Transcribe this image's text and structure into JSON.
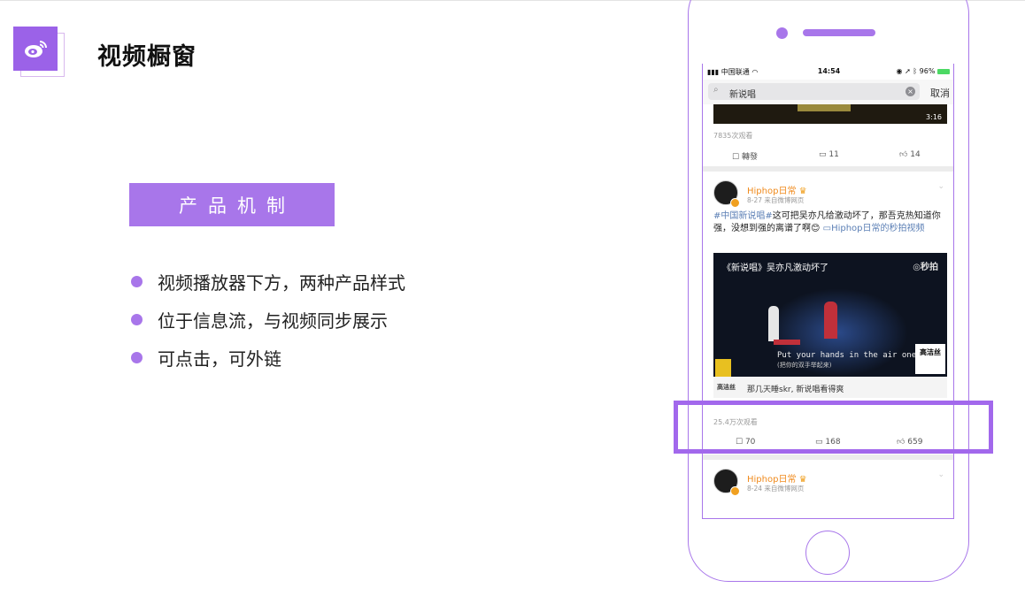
{
  "header": {
    "title": "视频橱窗",
    "logo_icon": "weibo-icon"
  },
  "section": {
    "badge": "产品机制",
    "bullets": [
      "视频播放器下方，两种产品样式",
      "位于信息流，与视频同步展示",
      "可点击，可外链"
    ]
  },
  "colors": {
    "accent": "#a876ea",
    "highlight": "#a268ec",
    "username": "#f08a1c",
    "topic": "#5b7fb5"
  },
  "phone": {
    "status": {
      "carrier": "中国联通",
      "time": "14:54",
      "battery": "96%"
    },
    "search": {
      "query": "新说唱",
      "cancel": "取消"
    },
    "card1": {
      "duration": "3:16",
      "views": "7835次观看",
      "repost": "轉發",
      "comments": "11",
      "likes": "14"
    },
    "card2": {
      "username": "Hiphop日常",
      "meta": "8-27 来自微博网页",
      "topic": "#中国新说唱#",
      "text": "这可把吴亦凡给激动坏了，那吾克热知道你强，没想到强的离谱了啊",
      "link": "Hiphop日常的秒拍视频",
      "video_title": "《新说唱》吴亦凡激动坏了",
      "watermark": "秒拍",
      "subtitle_en": "Put your hands in the air one time",
      "subtitle_cn": "(把你的双手举起来)",
      "brand": "高洁丝",
      "caption_logo": "高洁丝",
      "caption": "那几天睡skr, 新说唱看得爽",
      "views": "25.4万次观看",
      "reposts": "70",
      "comments": "168",
      "likes": "659"
    },
    "card3": {
      "username": "Hiphop日常",
      "meta": "8-24 来自微博网页"
    }
  }
}
